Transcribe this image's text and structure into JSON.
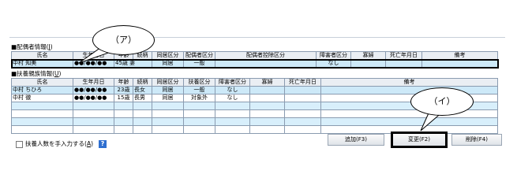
{
  "spouse_section": {
    "title": "■配偶者情報(",
    "shortcut": "J",
    "title_end": ")",
    "headers": [
      "氏名",
      "生年月日",
      "年齢",
      "続柄",
      "同居区分",
      "配偶者区分",
      "配偶者控除区分",
      "障害者区分",
      "寡婦",
      "死亡年月日",
      "備考"
    ],
    "row": {
      "name": "中村 知美",
      "birth": "●●/●●/●●",
      "age_rel": "45歳 妻",
      "cohab": "同居",
      "type": "一般"
    },
    "disability": "なし"
  },
  "dependent_section": {
    "title": "■扶養親族情報(",
    "shortcut": "U",
    "title_end": ")",
    "headers": [
      "氏名",
      "生年月日",
      "年齢",
      "続柄",
      "同居区分",
      "扶養区分",
      "障害者区分",
      "寡婦",
      "死亡年月日",
      "備考"
    ],
    "rows": [
      {
        "name": "中村 ちひろ",
        "birth": "●●/●●/●●",
        "age": "23歳",
        "relation": "長女",
        "cohab": "同居",
        "type": "一般",
        "disability": "なし"
      },
      {
        "name": "中村 徹",
        "birth": "●●/●●/●●",
        "age": "15歳",
        "relation": "長男",
        "cohab": "同居",
        "type": "対象外",
        "disability": "なし"
      }
    ]
  },
  "checkbox": {
    "label": "扶養人数を手入力する(",
    "shortcut": "A",
    "label_end": ")",
    "checked": false
  },
  "help_icon": "?",
  "buttons": {
    "add": "追加(F3)",
    "change": "変更(F2)",
    "delete": "削除(F4)"
  },
  "callouts": {
    "a": "（ア）",
    "i": "（イ）"
  },
  "colors": {
    "selection": "#cde9f8",
    "help": "#2f6fd0"
  }
}
